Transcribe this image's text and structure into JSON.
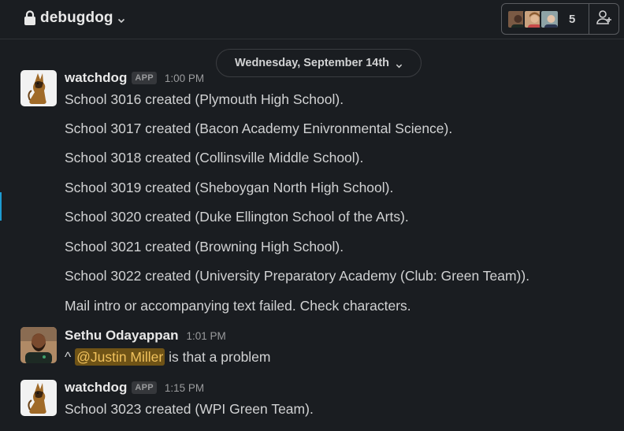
{
  "header": {
    "channel_name": "debugdog",
    "member_count": "5"
  },
  "date_divider": "Wednesday, September 14th",
  "messages": [
    {
      "sender": "watchdog",
      "badge": "APP",
      "time": "1:00 PM",
      "lines": [
        "School 3016 created (Plymouth High School).",
        "School 3017 created (Bacon Academy Enivronmental Science).",
        "School 3018 created (Collinsville Middle School).",
        "School 3019 created (Sheboygan North High School).",
        "School 3020 created (Duke Ellington School of the Arts).",
        "School 3021 created (Browning High School).",
        "School 3022 created (University Preparatory Academy (Club: Green Team)).",
        "Mail intro or accompanying text failed. Check characters."
      ]
    },
    {
      "sender": "Sethu Odayappan",
      "time": "1:01 PM",
      "prefix": "^",
      "mention": "@Justin Miller",
      "suffix": "is that a problem"
    },
    {
      "sender": "watchdog",
      "badge": "APP",
      "time": "1:15 PM",
      "lines": [
        "School 3023 created (WPI Green Team)."
      ]
    }
  ]
}
